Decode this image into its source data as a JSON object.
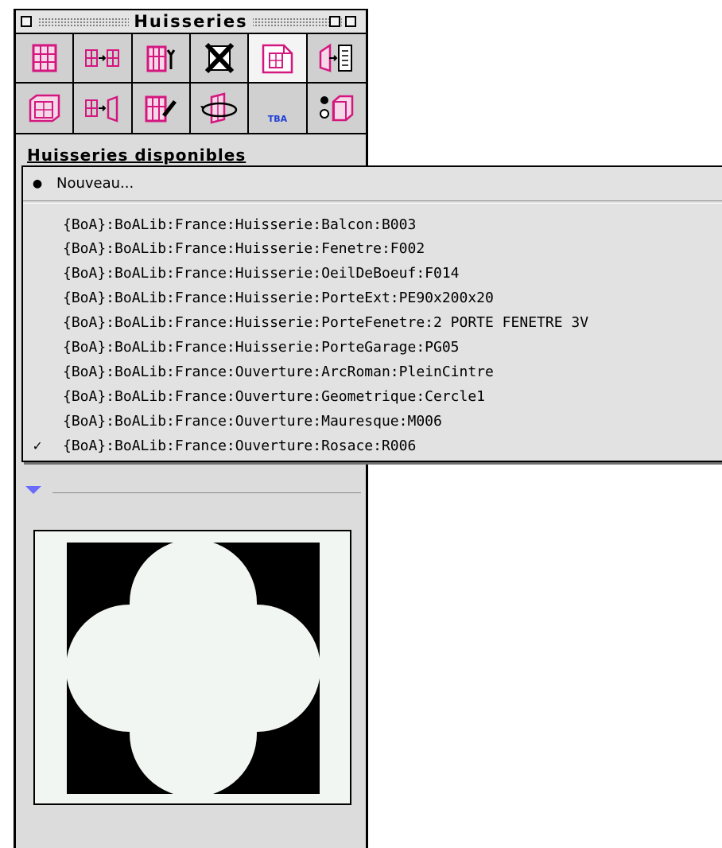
{
  "window": {
    "title": "Huisseries"
  },
  "tools": [
    {
      "icon": "window-grid-icon"
    },
    {
      "icon": "window-transfer-icon"
    },
    {
      "icon": "window-tools-icon"
    },
    {
      "icon": "delete-cross-icon"
    },
    {
      "icon": "window-document-icon"
    },
    {
      "icon": "door-insert-icon"
    },
    {
      "icon": "window-3d-icon"
    },
    {
      "icon": "window-to-door-icon"
    },
    {
      "icon": "window-edit-icon"
    },
    {
      "icon": "window-rotate-icon"
    },
    {
      "icon": "tba-icon",
      "label": "TBA"
    },
    {
      "icon": "toggle-3d-icon"
    }
  ],
  "section": {
    "title": "Huisseries disponibles"
  },
  "menu": {
    "new_item": "Nouveau...",
    "items": [
      "{BoA}:BoALib:France:Huisserie:Balcon:B003",
      "{BoA}:BoALib:France:Huisserie:Fenetre:F002",
      "{BoA}:BoALib:France:Huisserie:OeilDeBoeuf:F014",
      "{BoA}:BoALib:France:Huisserie:PorteExt:PE90x200x20",
      "{BoA}:BoALib:France:Huisserie:PorteFenetre:2 PORTE FENETRE 3V",
      "{BoA}:BoALib:France:Huisserie:PorteGarage:PG05",
      "{BoA}:BoALib:France:Ouverture:ArcRoman:PleinCintre",
      "{BoA}:BoALib:France:Ouverture:Geometrique:Cercle1",
      "{BoA}:BoALib:France:Ouverture:Mauresque:M006",
      "{BoA}:BoALib:France:Ouverture:Rosace:R006"
    ],
    "checked_item": "{BoA}:BoALib:France:Ouverture:Rosace:R006"
  },
  "colors": {
    "icon_magenta": "#d4177f",
    "tba_blue": "#1f3fd8",
    "disclosure_blue": "#6a6aff",
    "preview_shape": "#f2f6f2"
  }
}
